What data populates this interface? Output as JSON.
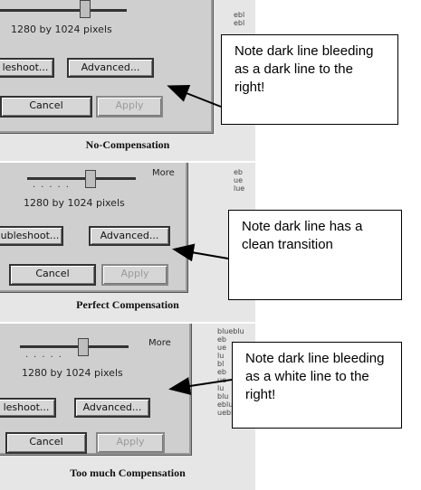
{
  "panels": [
    {
      "resolution": "1280 by 1024 pixels",
      "more_label": "",
      "troubleshoot_label": "leshoot...",
      "advanced_label": "Advanced...",
      "cancel_label": "Cancel",
      "apply_label": "Apply",
      "background_text": "ebl\nebl",
      "caption": "No-Compensation"
    },
    {
      "resolution": "1280 by 1024 pixels",
      "more_label": "More",
      "troubleshoot_label": "ubleshoot...",
      "advanced_label": "Advanced...",
      "cancel_label": "Cancel",
      "apply_label": "Apply",
      "background_text": "eb\nue\nlue",
      "caption": "Perfect Compensation"
    },
    {
      "resolution": "1280 by 1024 pixels",
      "more_label": "More",
      "troubleshoot_label": "leshoot...",
      "advanced_label": "Advanced...",
      "cancel_label": "Cancel",
      "apply_label": "Apply",
      "background_text": "blueblu\neb\nue\nlu\nbl\neb\nue\nlu\nblu\neblueb\nueblueb",
      "caption": "Too much Compensation"
    }
  ],
  "notes": [
    "Note dark line bleeding as a dark line to the right!",
    "Note dark line has a clean transition",
    "Note dark line bleeding as a white line to the right!"
  ]
}
